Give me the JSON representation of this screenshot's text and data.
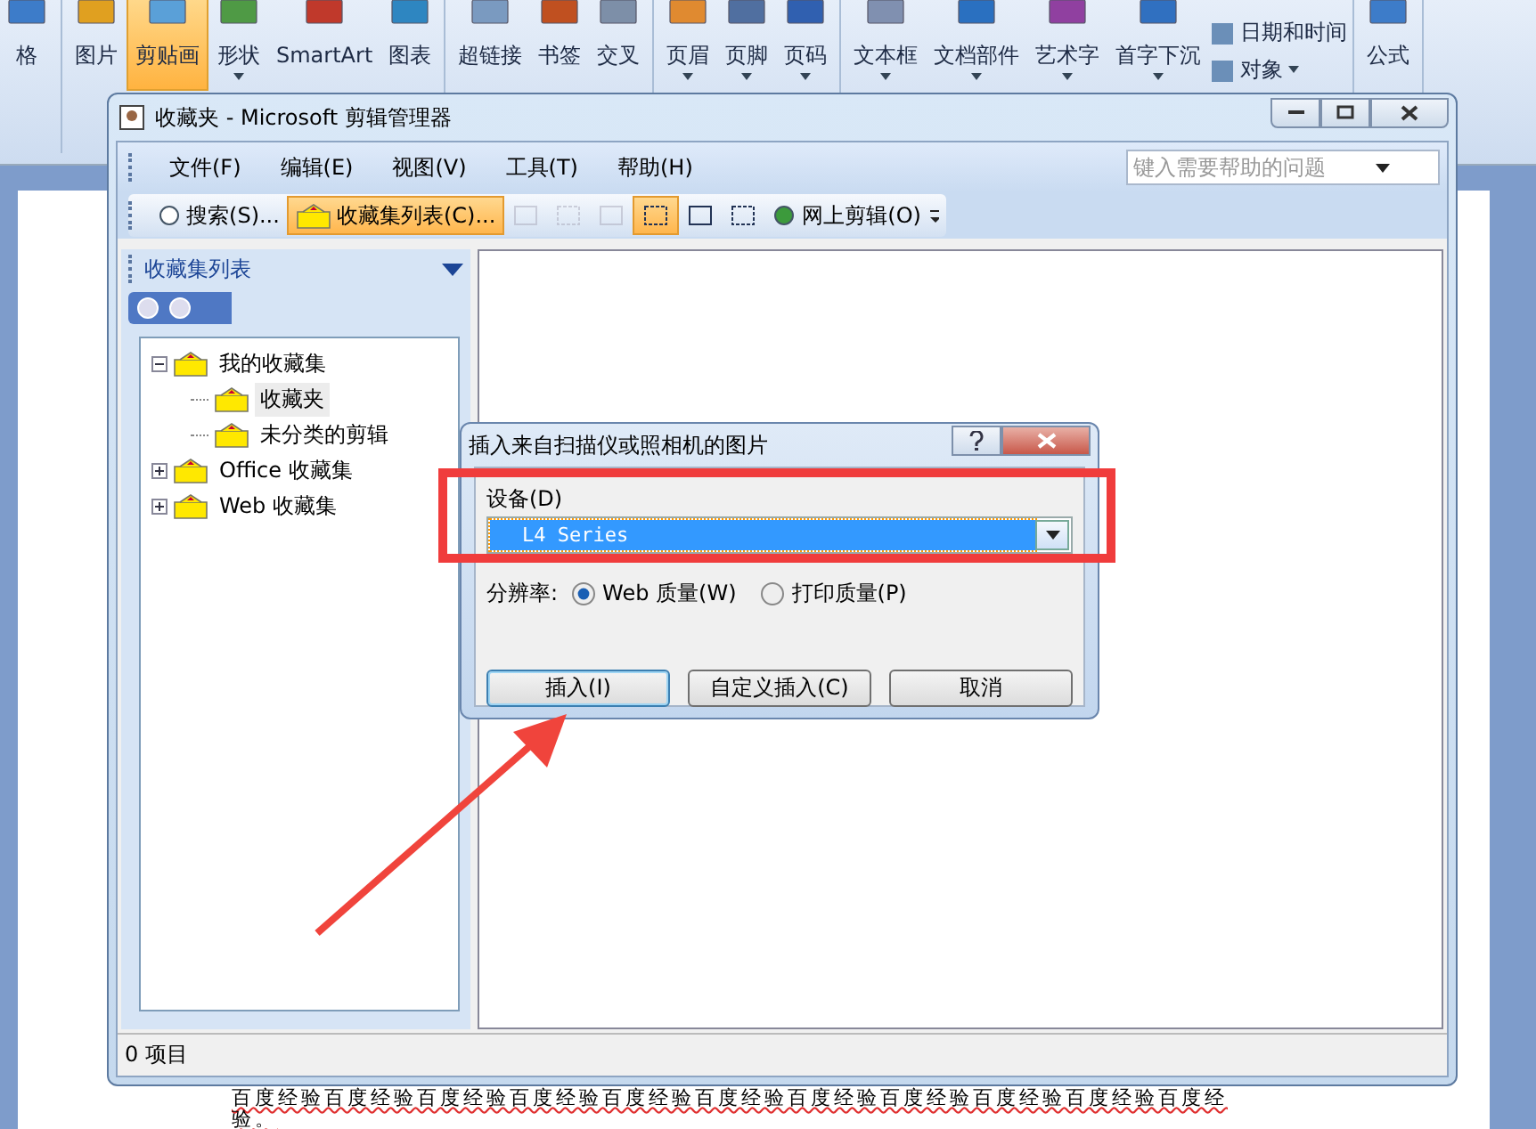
{
  "ribbon": {
    "groups": [
      {
        "items": [
          {
            "label": "格",
            "selected": false,
            "dropdown": false
          }
        ]
      },
      {
        "items": [
          {
            "label": "图片",
            "selected": false,
            "dropdown": false
          },
          {
            "label": "剪贴画",
            "selected": true,
            "dropdown": false
          },
          {
            "label": "形状",
            "selected": false,
            "dropdown": true
          },
          {
            "label": "SmartArt",
            "selected": false,
            "dropdown": false
          },
          {
            "label": "图表",
            "selected": false,
            "dropdown": false
          }
        ]
      },
      {
        "items": [
          {
            "label": "超链接",
            "selected": false,
            "dropdown": false
          },
          {
            "label": "书签",
            "selected": false,
            "dropdown": false
          },
          {
            "label": "交叉",
            "selected": false,
            "dropdown": false
          }
        ]
      },
      {
        "items": [
          {
            "label": "页眉",
            "selected": false,
            "dropdown": true
          },
          {
            "label": "页脚",
            "selected": false,
            "dropdown": true
          },
          {
            "label": "页码",
            "selected": false,
            "dropdown": true
          }
        ]
      },
      {
        "items": [
          {
            "label": "文本框",
            "selected": false,
            "dropdown": true
          },
          {
            "label": "文档部件",
            "selected": false,
            "dropdown": true
          },
          {
            "label": "艺术字",
            "selected": false,
            "dropdown": true
          },
          {
            "label": "首字下沉",
            "selected": false,
            "dropdown": true
          }
        ],
        "small_items": [
          {
            "label": "日期和时间",
            "dropdown": false
          },
          {
            "label": "对象",
            "dropdown": true
          }
        ]
      },
      {
        "items": [
          {
            "label": "公式",
            "selected": false,
            "dropdown": false
          }
        ]
      }
    ]
  },
  "document": {
    "lines": [
      "百度经验百度经验百度经验百度经验百度经验百度经验百度经验百度经验百度经验百度经验百度经",
      "验。"
    ]
  },
  "organizer": {
    "title": "收藏夹 - Microsoft 剪辑管理器",
    "menus": [
      "文件(F)",
      "编辑(E)",
      "视图(V)",
      "工具(T)",
      "帮助(H)"
    ],
    "help_search": {
      "placeholder": "键入需要帮助的问题"
    },
    "toolbar": [
      {
        "kind": "text",
        "label": "搜索(S)...",
        "selected": false,
        "disabled": false
      },
      {
        "kind": "text",
        "label": "收藏集列表(C)...",
        "selected": true,
        "disabled": false
      },
      {
        "kind": "icon",
        "selected": false,
        "disabled": true
      },
      {
        "kind": "icon",
        "selected": false,
        "disabled": true
      },
      {
        "kind": "icon",
        "selected": false,
        "disabled": true
      },
      {
        "kind": "icon",
        "selected": true,
        "disabled": false
      },
      {
        "kind": "icon",
        "selected": false,
        "disabled": false
      },
      {
        "kind": "icon",
        "selected": false,
        "disabled": false
      },
      {
        "kind": "text",
        "label": "网上剪辑(O)",
        "selected": false,
        "disabled": false
      }
    ],
    "task_pane": {
      "title": "收藏集列表",
      "tree": [
        {
          "label": "我的收藏集",
          "selected": false,
          "expanded": true,
          "children": [
            {
              "label": "收藏夹",
              "selected": true
            },
            {
              "label": "未分类的剪辑",
              "selected": false
            }
          ]
        },
        {
          "label": "Office 收藏集",
          "selected": false,
          "expanded": false
        },
        {
          "label": "Web 收藏集",
          "selected": false,
          "expanded": false
        }
      ]
    },
    "status_bar": "0 项目"
  },
  "dialog": {
    "title": "插入来自扫描仪或照相机的图片",
    "device_label": "设备(D)",
    "device_value": "L4 Series",
    "resolution_label": "分辨率:",
    "resolutions": [
      {
        "label": "Web 质量(W)",
        "selected": true
      },
      {
        "label": "打印质量(P)",
        "selected": false
      }
    ],
    "buttons": [
      {
        "label": "插入(I)",
        "default": true
      },
      {
        "label": "自定义插入(C)",
        "default": false
      },
      {
        "label": "取消",
        "default": false
      }
    ]
  }
}
